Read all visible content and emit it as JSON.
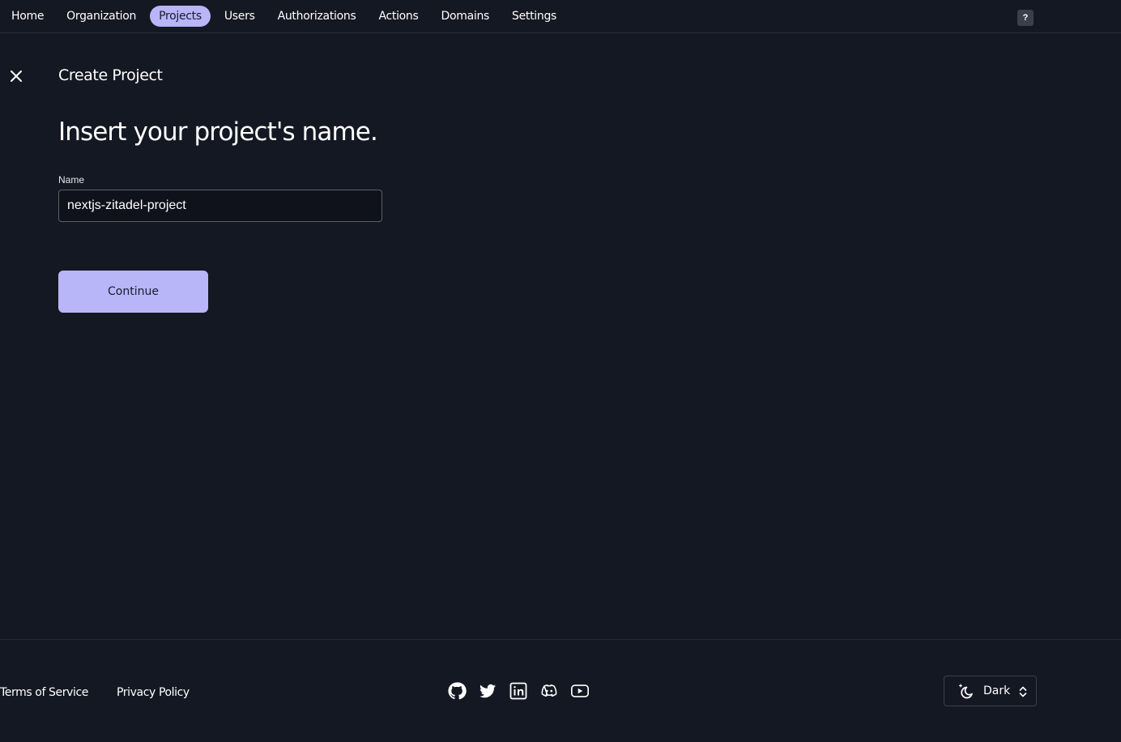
{
  "nav": {
    "items": [
      {
        "label": "Home",
        "active": false
      },
      {
        "label": "Organization",
        "active": false
      },
      {
        "label": "Projects",
        "active": true
      },
      {
        "label": "Users",
        "active": false
      },
      {
        "label": "Authorizations",
        "active": false
      },
      {
        "label": "Actions",
        "active": false
      },
      {
        "label": "Domains",
        "active": false
      },
      {
        "label": "Settings",
        "active": false
      }
    ],
    "help_label": "?"
  },
  "page": {
    "title": "Create Project",
    "heading": "Insert your project's name."
  },
  "form": {
    "name_label": "Name",
    "name_value": "nextjs-zitadel-project",
    "continue_label": "Continue"
  },
  "footer": {
    "terms_label": "Terms of Service",
    "privacy_label": "Privacy Policy",
    "socials": [
      "github-icon",
      "twitter-icon",
      "linkedin-icon",
      "discord-icon",
      "youtube-icon"
    ],
    "theme_label": "Dark"
  },
  "colors": {
    "background": "#141822",
    "accent": "#b8b5f8"
  }
}
